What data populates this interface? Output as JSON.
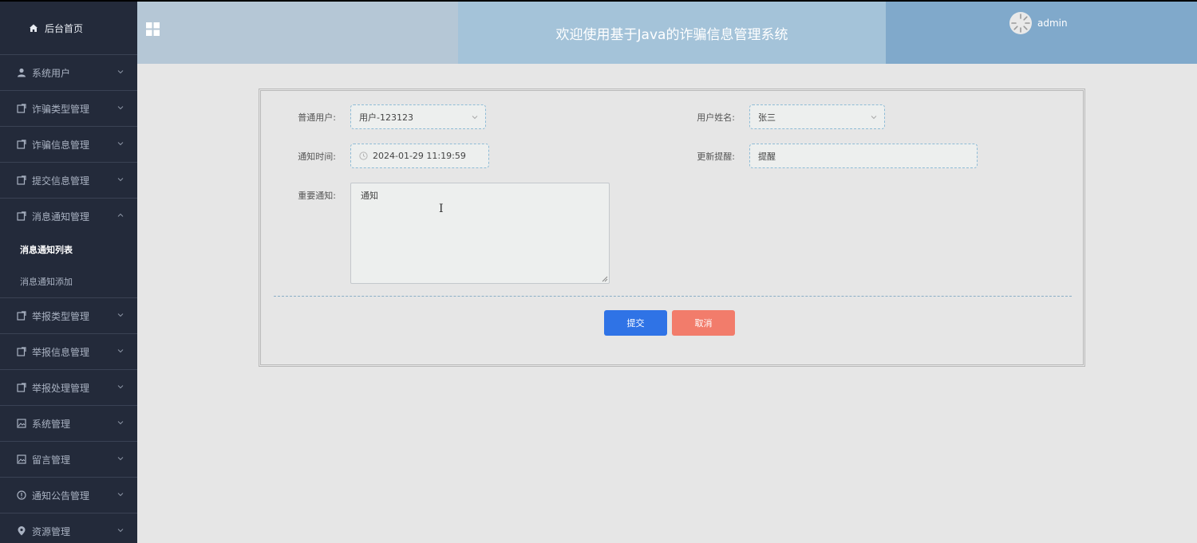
{
  "sidebar": {
    "home_label": "后台首页",
    "items": [
      {
        "label": "系统用户",
        "icon": "user-icon"
      },
      {
        "label": "诈骗类型管理",
        "icon": "document-icon"
      },
      {
        "label": "诈骗信息管理",
        "icon": "document-icon"
      },
      {
        "label": "提交信息管理",
        "icon": "document-icon"
      },
      {
        "label": "消息通知管理",
        "icon": "document-icon",
        "expanded": true
      },
      {
        "label": "举报类型管理",
        "icon": "document-icon"
      },
      {
        "label": "举报信息管理",
        "icon": "document-icon"
      },
      {
        "label": "举报处理管理",
        "icon": "document-icon"
      },
      {
        "label": "系统管理",
        "icon": "picture-icon"
      },
      {
        "label": "留言管理",
        "icon": "picture-icon"
      },
      {
        "label": "通知公告管理",
        "icon": "info-circle-icon"
      },
      {
        "label": "资源管理",
        "icon": "location-icon"
      }
    ],
    "sub_items": [
      {
        "label": "消息通知列表",
        "active": true
      },
      {
        "label": "消息通知添加",
        "active": false
      }
    ]
  },
  "header": {
    "title": "欢迎使用基于Java的诈骗信息管理系统",
    "username": "admin",
    "colors": {
      "seg1": "#b5c7d6",
      "seg2": "#a4c3d9",
      "seg3": "#80a9cb"
    }
  },
  "form": {
    "user_label": "普通用户:",
    "user_value": "用户-123123",
    "name_label": "用户姓名:",
    "name_value": "张三",
    "time_label": "通知时间:",
    "time_value": "2024-01-29 11:19:59",
    "remind_label": "更新提醒:",
    "remind_value": "提醒",
    "notice_label": "重要通知:",
    "notice_value": "通知",
    "submit_label": "提交",
    "cancel_label": "取消"
  }
}
